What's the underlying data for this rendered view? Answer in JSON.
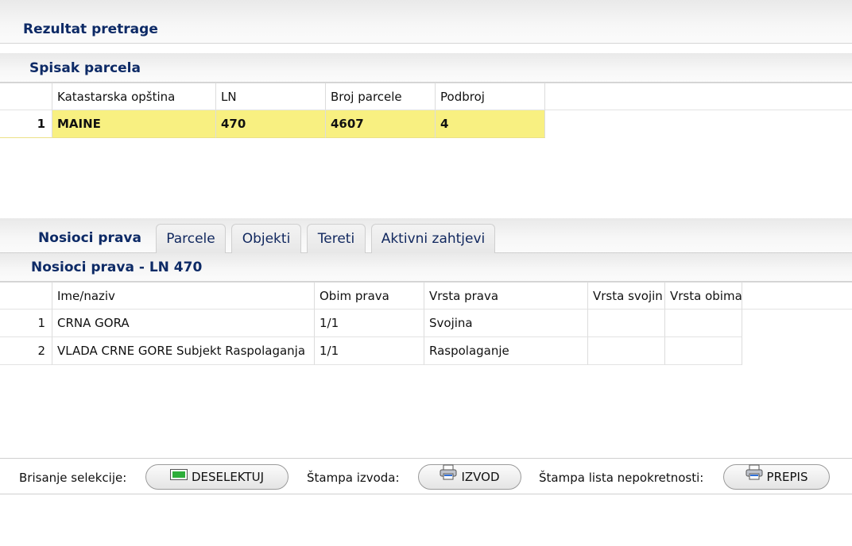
{
  "header": {
    "title": "Rezultat pretrage"
  },
  "parcels": {
    "title": "Spisak parcela",
    "columns": [
      "Katastarska opština",
      "LN",
      "Broj parcele",
      "Podbroj"
    ],
    "rows": [
      {
        "num": "1",
        "cells": [
          "MAINE",
          "470",
          "4607",
          "4"
        ]
      }
    ]
  },
  "tabs": [
    {
      "label": "Nosioci prava"
    },
    {
      "label": "Parcele"
    },
    {
      "label": "Objekti"
    },
    {
      "label": "Tereti"
    },
    {
      "label": "Aktivni zahtjevi"
    }
  ],
  "owners": {
    "title": "Nosioci prava - LN 470",
    "columns": [
      "Ime/naziv",
      "Obim prava",
      "Vrsta prava",
      "Vrsta svojin",
      "Vrsta obima"
    ],
    "rows": [
      {
        "num": "1",
        "cells": [
          "CRNA GORA",
          "1/1",
          "Svojina",
          "",
          ""
        ]
      },
      {
        "num": "2",
        "cells": [
          "VLADA CRNE GORE Subjekt Raspolaganja",
          "1/1",
          "Raspolaganje",
          "",
          ""
        ]
      }
    ]
  },
  "toolbar": {
    "deselect_label": "Brisanje selekcije:",
    "deselect_button": "DESELEKTUJ",
    "print_label": "Štampa izvoda:",
    "print_button": "IZVOD",
    "copy_label": "Štampa lista nepokretnosti:",
    "copy_button": "PREPIS"
  },
  "colors": {
    "accent": "#0d2a66",
    "selected_row": "#f8f081"
  },
  "icons": {
    "deselect": "green-bar-icon",
    "print": "printer-icon",
    "copy": "printer-icon"
  }
}
